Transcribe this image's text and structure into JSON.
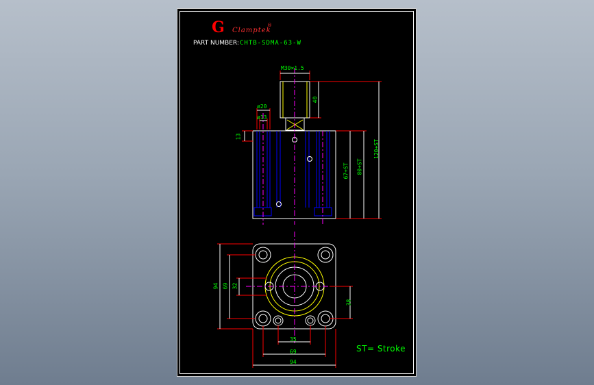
{
  "logo": {
    "letter": "G",
    "brand": "Clamptek",
    "mark": "®"
  },
  "part_label": "PART NUMBER:",
  "part_number": "CHTB-SDMA-63-W",
  "side_view": {
    "thread": "M30×1.5",
    "dims": {
      "d1": "ø20",
      "d2": "ø13",
      "h1": "13",
      "h2": "40",
      "h3": "67+ST",
      "h4": "80+ST",
      "h5": "120+ST"
    }
  },
  "bottom_view": {
    "dims": {
      "w_outer": "94",
      "w_mid": "69",
      "w_inner": "35",
      "v_outer": "94",
      "v_mid": "69",
      "v_inner": "32",
      "v_right": "38"
    }
  },
  "legend": "ST= Stroke",
  "colors": {
    "dim": "#00ff00",
    "line": "#ffffff",
    "hidden": "#0000ff",
    "extension": "#ff0000",
    "center": "#ff00ff",
    "thread": "#ffff00",
    "logo": "#ff0000"
  }
}
